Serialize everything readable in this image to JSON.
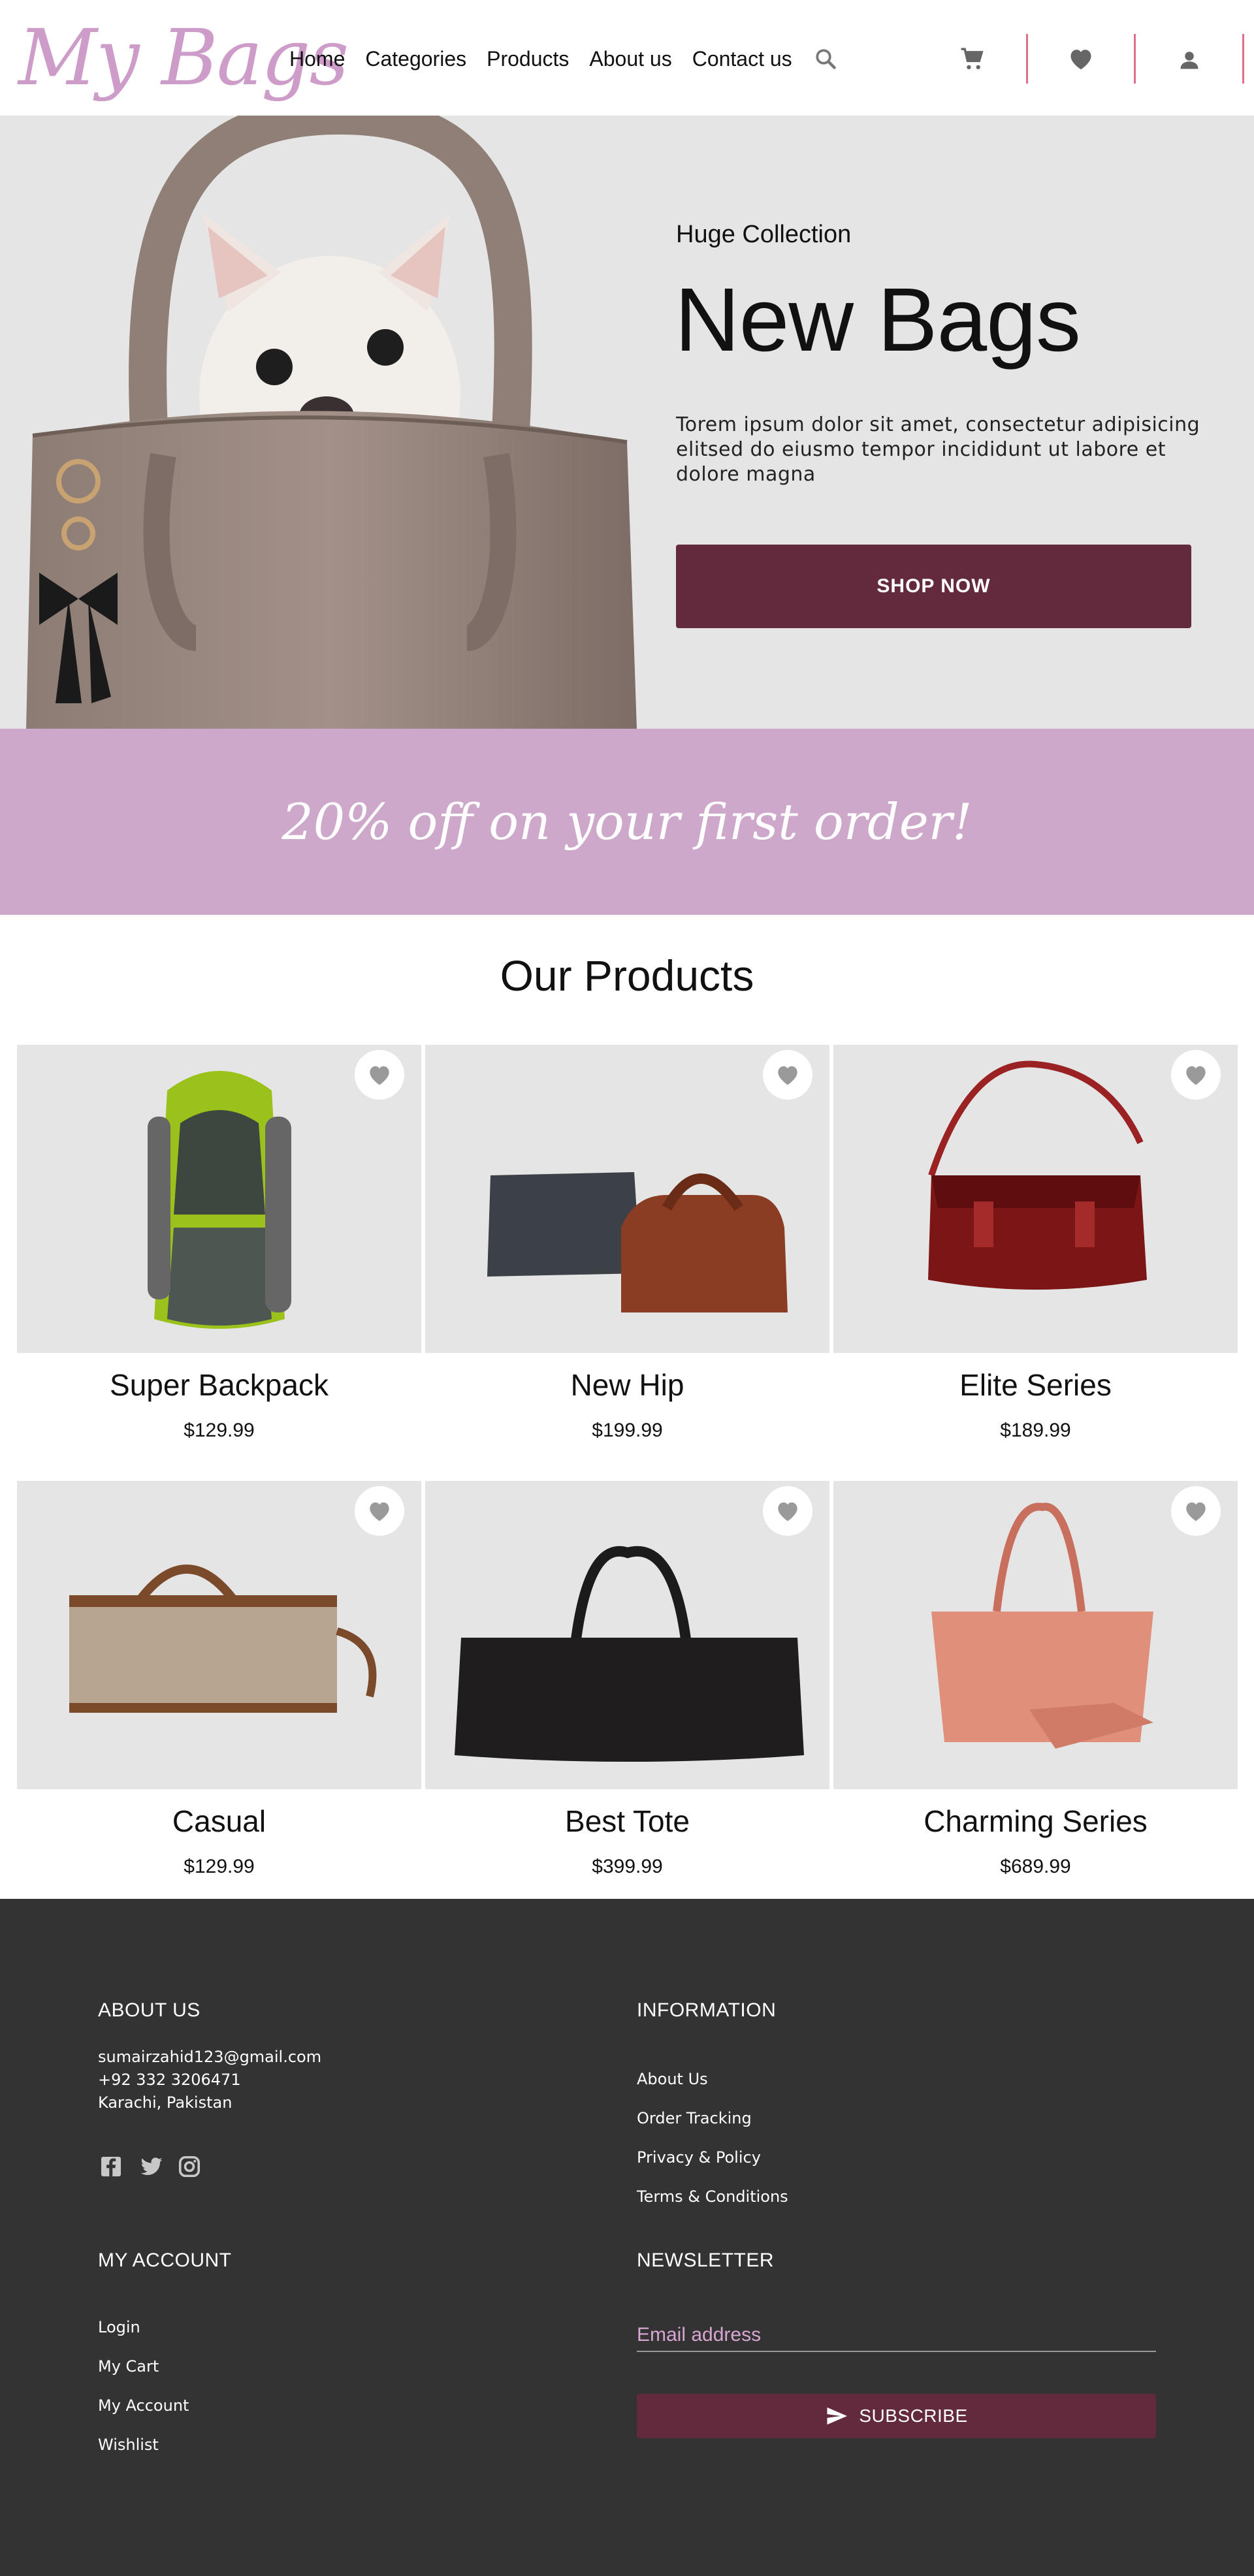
{
  "brand": {
    "logo_text": "My Bags",
    "accent": "#cd9cc8",
    "primary": "#622a3c"
  },
  "nav": {
    "links": [
      "Home",
      "Categories",
      "Products",
      "About us",
      "Contact us"
    ],
    "icons": [
      "search-icon",
      "cart-icon",
      "heart-icon",
      "user-icon"
    ]
  },
  "hero": {
    "eyebrow": "Huge Collection",
    "title": "New Bags",
    "description": "Torem ipsum dolor sit amet, consectetur adipisicing elitsed do eiusmo tempor incididunt ut labore et dolore magna",
    "button": "SHOP NOW"
  },
  "promo": {
    "text": "20% off on your first order!"
  },
  "products": {
    "title": "Our Products",
    "items": [
      {
        "name": "Super Backpack",
        "price": "$129.99"
      },
      {
        "name": "New Hip",
        "price": "$199.99"
      },
      {
        "name": "Elite Series",
        "price": "$189.99"
      },
      {
        "name": "Casual",
        "price": "$129.99"
      },
      {
        "name": "Best Tote",
        "price": "$399.99"
      },
      {
        "name": "Charming Series",
        "price": "$689.99"
      }
    ]
  },
  "footer": {
    "about": {
      "heading": "ABOUT US",
      "email": "sumairzahid123@gmail.com",
      "phone": "+92 332 3206471",
      "address": "Karachi, Pakistan",
      "social": [
        "facebook-icon",
        "twitter-icon",
        "instagram-icon"
      ]
    },
    "information": {
      "heading": "INFORMATION",
      "links": [
        "About Us",
        "Order Tracking",
        "Privacy & Policy",
        "Terms & Conditions"
      ]
    },
    "account": {
      "heading": "MY ACCOUNT",
      "links": [
        "Login",
        "My Cart",
        "My Account",
        "Wishlist"
      ]
    },
    "newsletter": {
      "heading": "NEWSLETTER",
      "placeholder": "Email address",
      "button": "SUBSCRIBE"
    }
  }
}
